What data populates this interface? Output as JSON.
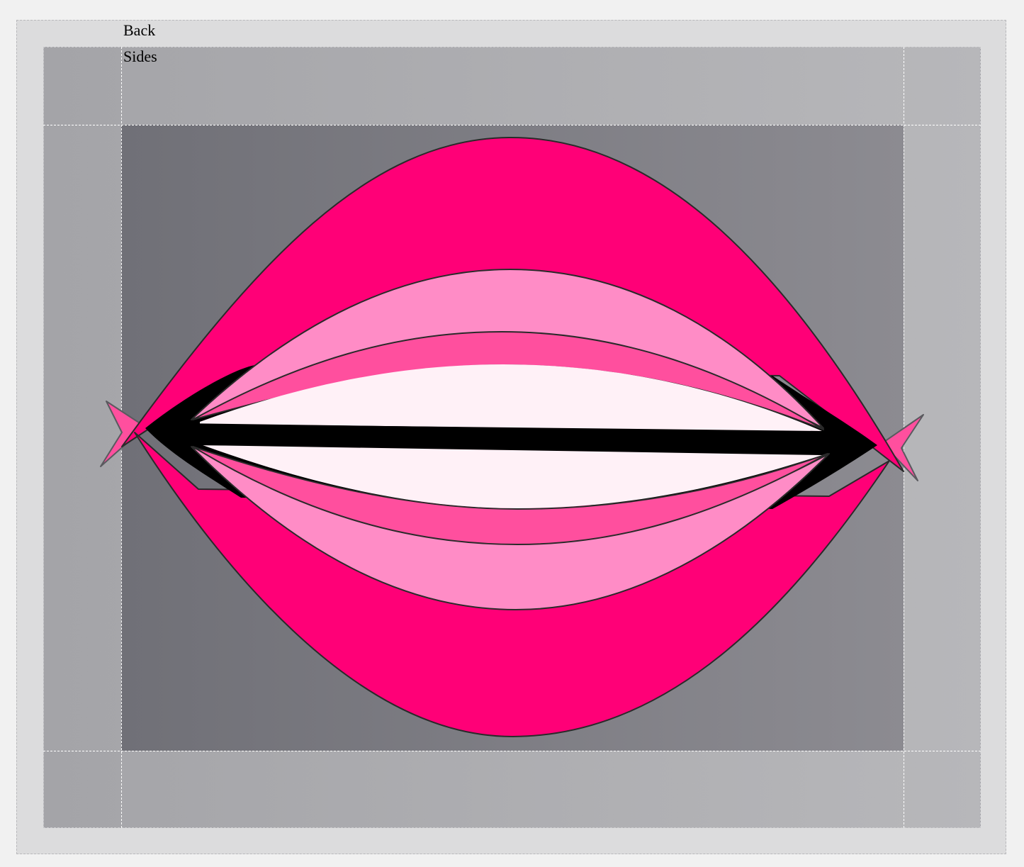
{
  "labels": {
    "back": "Back",
    "sides": "Sides"
  },
  "colors": {
    "background": "#f1f1f1",
    "outer_frame": "#dcdcdd",
    "sides_panel": "#adadb1",
    "back_panel": "#7c7b82",
    "guides": "#ffffff",
    "lips_outer": "#ff0077",
    "lips_mid": "#ff8cc6",
    "lips_inner": "#ff4f9e",
    "teeth": "#fff1f7",
    "mouth_line": "#000000"
  },
  "illustration": {
    "subject": "lips-icon"
  }
}
